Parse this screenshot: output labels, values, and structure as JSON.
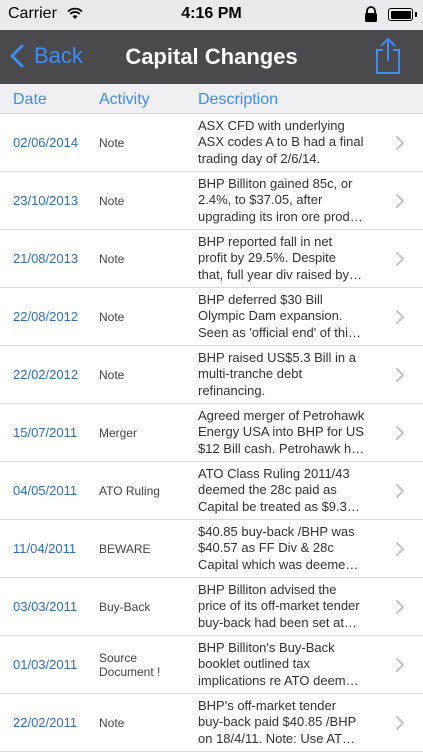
{
  "status_bar": {
    "carrier": "Carrier",
    "time": "4:16 PM"
  },
  "nav": {
    "back_label": "Back",
    "title": "Capital Changes"
  },
  "columns": {
    "date": "Date",
    "activity": "Activity",
    "description": "Description"
  },
  "rows": [
    {
      "date": "02/06/2014",
      "activity": "Note",
      "desc": [
        "ASX CFD with underlying",
        "ASX codes A to B had a final",
        "trading day of 2/6/14."
      ]
    },
    {
      "date": "23/10/2013",
      "activity": "Note",
      "desc": [
        "BHP Billiton gained 85c, or",
        "2.4%, to $37.05, after",
        "upgrading its iron ore prod…"
      ]
    },
    {
      "date": "21/08/2013",
      "activity": "Note",
      "desc": [
        "BHP reported fall in net",
        "profit by 29.5%. Despite",
        "that, full year div raised by…"
      ]
    },
    {
      "date": "22/08/2012",
      "activity": "Note",
      "desc": [
        "BHP deferred $30 Bill",
        "Olympic Dam expansion.",
        "Seen as 'official end' of thi…"
      ]
    },
    {
      "date": "22/02/2012",
      "activity": "Note",
      "desc": [
        "BHP raised US$5.3 Bill in a",
        "multi-tranche debt",
        "refinancing."
      ]
    },
    {
      "date": "15/07/2011",
      "activity": "Merger",
      "desc": [
        "Agreed merger of Petrohawk",
        "Energy USA into BHP for US",
        "$12 Bill cash. Petrohawk h…"
      ]
    },
    {
      "date": "04/05/2011",
      "activity": "ATO Ruling",
      "desc": [
        "ATO Class Ruling 2011/43",
        "deemed the 28c paid as",
        "Capital be treated as $9.3…"
      ]
    },
    {
      "date": "11/04/2011",
      "activity": "BEWARE",
      "desc": [
        "$40.85 buy-back /BHP was",
        "$40.57 as FF Div & 28c",
        "Capital which was deeme…"
      ]
    },
    {
      "date": "03/03/2011",
      "activity": "Buy-Back",
      "desc": [
        "BHP Billiton advised the",
        "price of its off-market tender",
        "buy-back had been set at…"
      ]
    },
    {
      "date": "01/03/2011",
      "activity": "Source Document !",
      "desc": [
        "BHP Billiton's Buy-Back",
        "booklet outlined tax",
        "implications re ATO deem…"
      ]
    },
    {
      "date": "22/02/2011",
      "activity": "Note",
      "desc": [
        "BHP's off-market tender",
        "buy-back paid $40.85 /BHP",
        "on 18/4/11. Note: Use AT…"
      ]
    }
  ],
  "colors": {
    "accent": "#3d8ef0",
    "navbar": "#4a4a4e",
    "header_bg": "#efeff4",
    "date_text": "#2f6fc0"
  },
  "icons": {
    "back": "chevron-left-icon",
    "share": "share-icon",
    "row": "chevron-right-icon",
    "wifi": "wifi-icon",
    "battery": "battery-icon",
    "rotation_lock": "rotation-lock-icon"
  }
}
